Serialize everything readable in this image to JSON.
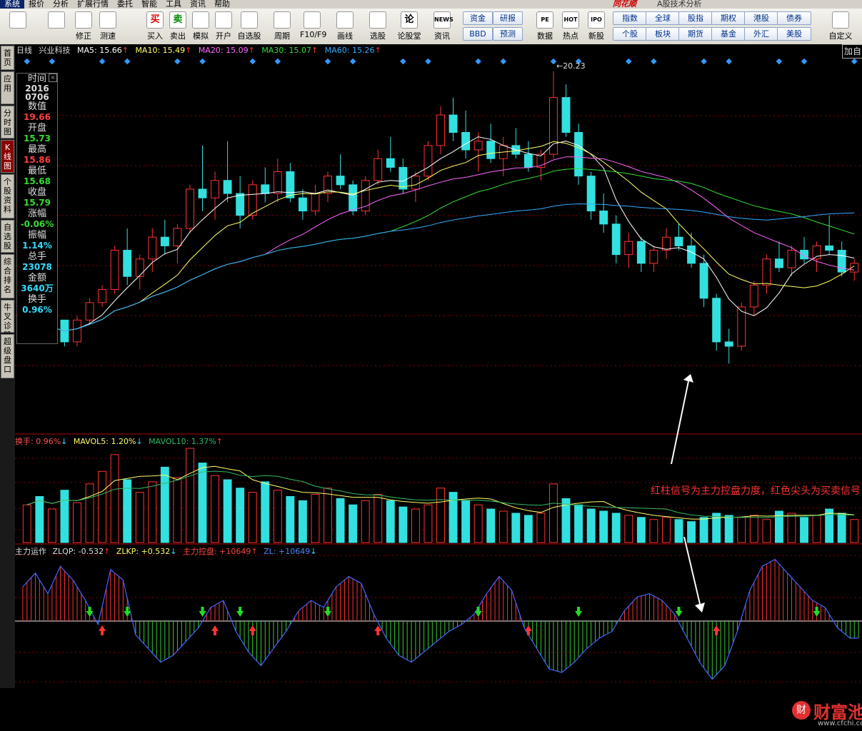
{
  "menu": {
    "items": [
      "系统",
      "报价",
      "分析",
      "扩展行情",
      "委托",
      "智能",
      "工具",
      "资讯",
      "帮助"
    ],
    "active_index": 0,
    "app_title": "同花顺",
    "subtitle": "A股技术分析"
  },
  "toolbar": {
    "buttons": [
      {
        "name": "layout-icon",
        "label": ""
      },
      {
        "name": "back-arrow-icon",
        "label": ""
      },
      {
        "name": "modify-button",
        "label": "修正"
      },
      {
        "name": "speed-test-button",
        "label": "测速"
      },
      {
        "name": "buy-button",
        "label": "买入",
        "glyph": "买"
      },
      {
        "name": "sell-button",
        "label": "卖出",
        "glyph": "卖"
      },
      {
        "name": "simulate-button",
        "label": "模拟"
      },
      {
        "name": "open-account-button",
        "label": "开户"
      },
      {
        "name": "watchlist-button",
        "label": "自选股"
      },
      {
        "name": "period-button",
        "label": "周期"
      },
      {
        "name": "f10-button",
        "label": "F10/F9"
      },
      {
        "name": "draw-line-button",
        "label": "画线"
      },
      {
        "name": "stock-select-button",
        "label": "选股"
      },
      {
        "name": "forum-button",
        "label": "论股堂",
        "glyph": "论"
      },
      {
        "name": "news-button",
        "label": "资讯",
        "glyph": "NEWS"
      },
      {
        "name": "data-button",
        "label": "数据",
        "glyph": "PE"
      },
      {
        "name": "hot-button",
        "label": "热点",
        "glyph": "HOT"
      },
      {
        "name": "new-stock-button",
        "label": "新股",
        "glyph": "IPO"
      },
      {
        "name": "customize-button",
        "label": "自定义"
      }
    ],
    "text_buttons": [
      "资金",
      "研报",
      "BBD",
      "预测",
      "指数",
      "全球",
      "股指",
      "期权",
      "港股",
      "债券",
      "个股",
      "板块",
      "期货",
      "基金",
      "外汇",
      "美股"
    ]
  },
  "left_nav": {
    "tabs": [
      "首页",
      "应用",
      "分时图",
      "K线图",
      "个股资料",
      "自选股",
      "综合排名",
      "牛叉诊股",
      "超级盘口"
    ],
    "active_index": 3
  },
  "kline_header": {
    "period": "日线",
    "stock_name": "兴业科技",
    "ma5": "MA5: 15.66",
    "ma10": "MA10: 15.49",
    "ma20": "MA20: 15.09",
    "ma30": "MA30: 15.07",
    "ma60": "MA60: 15.26",
    "add_button": "加自"
  },
  "info_box": {
    "items": [
      {
        "key": "时间",
        "value": "2016\n0706",
        "color": "#dddddd"
      },
      {
        "key": "数值",
        "value": "19.66",
        "color": "#ff4040"
      },
      {
        "key": "开盘",
        "value": "15.73",
        "color": "#33dd33"
      },
      {
        "key": "最高",
        "value": "15.86",
        "color": "#ff4040"
      },
      {
        "key": "最低",
        "value": "15.68",
        "color": "#33dd33"
      },
      {
        "key": "收盘",
        "value": "15.79",
        "color": "#33dd33"
      },
      {
        "key": "涨幅",
        "value": "-0.06%",
        "color": "#33dd33"
      },
      {
        "key": "振幅",
        "value": "1.14%",
        "color": "#33ddff"
      },
      {
        "key": "总手",
        "value": "23078",
        "color": "#33ddff"
      },
      {
        "key": "金额",
        "value": "3640万",
        "color": "#33ddff"
      },
      {
        "key": "换手",
        "value": "0.96%",
        "color": "#33ddff"
      }
    ],
    "close_glyph": "×"
  },
  "volume_header": {
    "turnover": "换手: 0.96%",
    "mavol5": "MAVOL5: 1.20%",
    "mavol10": "MAVOL10: 1.37%"
  },
  "zl_header": {
    "title": "主力运作",
    "zlqp": "ZLQP: -0.532",
    "zlkp": "ZLKP: +0.532",
    "zhulikongpan": "主力控盘: +10649",
    "zl": "ZL: +10649"
  },
  "annotation": {
    "text": "红柱信号为主力控盘力度，红色尖头为买卖信号"
  },
  "logo": {
    "mark": "财",
    "name": "财富池",
    "url": "www.cfchi.com"
  },
  "colors": {
    "up": "#ff3333",
    "down": "#33e0e0",
    "ma5": "#ffffff",
    "ma10": "#ffff66",
    "ma20": "#ff66ff",
    "ma30": "#33dd33",
    "ma60": "#33aaff",
    "grid": "#8b0000"
  },
  "chart_data": {
    "type": "candlestick",
    "price_high_label": "20.23",
    "price_max": 20.23,
    "price_min": 13.5,
    "candles": [
      [
        14.1,
        14.4,
        14.0,
        14.3
      ],
      [
        14.3,
        14.5,
        14.1,
        14.2
      ],
      [
        14.2,
        14.6,
        14.1,
        14.5
      ],
      [
        14.5,
        14.5,
        13.9,
        14.0
      ],
      [
        14.0,
        14.6,
        13.9,
        14.5
      ],
      [
        14.5,
        15.0,
        14.4,
        14.9
      ],
      [
        14.9,
        15.3,
        14.8,
        15.2
      ],
      [
        15.2,
        16.2,
        15.1,
        16.1
      ],
      [
        16.1,
        16.6,
        15.3,
        15.5
      ],
      [
        15.5,
        16.0,
        15.2,
        15.9
      ],
      [
        15.9,
        16.6,
        15.6,
        16.4
      ],
      [
        16.4,
        16.8,
        16.0,
        16.2
      ],
      [
        16.2,
        16.7,
        15.8,
        16.6
      ],
      [
        16.6,
        17.6,
        16.5,
        17.5
      ],
      [
        17.5,
        18.5,
        17.0,
        17.3
      ],
      [
        17.3,
        17.9,
        16.8,
        17.7
      ],
      [
        17.7,
        18.6,
        17.2,
        17.4
      ],
      [
        17.4,
        17.8,
        16.6,
        16.9
      ],
      [
        16.9,
        17.7,
        16.8,
        17.6
      ],
      [
        17.6,
        18.0,
        17.2,
        17.4
      ],
      [
        17.4,
        18.2,
        17.2,
        17.9
      ],
      [
        17.9,
        18.1,
        17.2,
        17.3
      ],
      [
        17.3,
        17.5,
        16.8,
        17.0
      ],
      [
        17.0,
        17.6,
        16.9,
        17.4
      ],
      [
        17.4,
        17.9,
        17.2,
        17.8
      ],
      [
        17.8,
        18.3,
        17.5,
        17.6
      ],
      [
        17.6,
        17.7,
        16.9,
        17.0
      ],
      [
        17.0,
        17.8,
        16.9,
        17.7
      ],
      [
        17.7,
        18.4,
        17.6,
        18.2
      ],
      [
        18.2,
        18.7,
        17.9,
        18.0
      ],
      [
        18.0,
        18.2,
        17.4,
        17.5
      ],
      [
        17.5,
        17.9,
        17.2,
        17.8
      ],
      [
        17.8,
        18.6,
        17.7,
        18.5
      ],
      [
        18.5,
        19.4,
        18.3,
        19.2
      ],
      [
        19.2,
        19.6,
        18.6,
        18.8
      ],
      [
        18.8,
        19.3,
        18.2,
        18.4
      ],
      [
        18.4,
        18.8,
        17.9,
        18.6
      ],
      [
        18.6,
        19.0,
        18.1,
        18.2
      ],
      [
        18.2,
        18.7,
        17.8,
        18.5
      ],
      [
        18.5,
        18.9,
        18.2,
        18.3
      ],
      [
        18.3,
        18.6,
        17.9,
        18.0
      ],
      [
        18.0,
        18.4,
        17.7,
        18.3
      ],
      [
        18.3,
        20.2,
        18.2,
        19.6
      ],
      [
        19.6,
        19.9,
        18.7,
        18.8
      ],
      [
        18.8,
        19.0,
        17.6,
        17.8
      ],
      [
        17.8,
        17.9,
        16.8,
        17.0
      ],
      [
        17.0,
        17.4,
        16.5,
        16.7
      ],
      [
        16.7,
        16.9,
        15.8,
        16.0
      ],
      [
        16.0,
        16.5,
        15.7,
        16.3
      ],
      [
        16.3,
        16.4,
        15.6,
        15.8
      ],
      [
        15.8,
        16.2,
        15.6,
        16.1
      ],
      [
        16.1,
        16.6,
        15.9,
        16.4
      ],
      [
        16.4,
        16.7,
        16.1,
        16.2
      ],
      [
        16.2,
        16.5,
        15.7,
        15.8
      ],
      [
        15.8,
        16.0,
        14.8,
        15.0
      ],
      [
        15.0,
        15.1,
        13.8,
        14.0
      ],
      [
        14.0,
        14.3,
        13.5,
        13.9
      ],
      [
        13.9,
        14.9,
        13.8,
        14.8
      ],
      [
        14.8,
        15.4,
        14.6,
        15.3
      ],
      [
        15.3,
        16.0,
        15.1,
        15.9
      ],
      [
        15.9,
        16.3,
        15.6,
        15.7
      ],
      [
        15.7,
        16.2,
        15.5,
        16.1
      ],
      [
        16.1,
        16.4,
        15.8,
        15.9
      ],
      [
        15.9,
        16.3,
        15.6,
        16.2
      ],
      [
        16.2,
        16.9,
        16.0,
        16.1
      ],
      [
        16.1,
        16.3,
        15.5,
        15.6
      ],
      [
        15.6,
        15.9,
        15.4,
        15.8
      ]
    ],
    "volume": [
      1.8,
      2.2,
      1.6,
      2.5,
      1.9,
      2.8,
      3.4,
      4.2,
      3.0,
      2.4,
      2.9,
      3.6,
      3.1,
      4.5,
      3.8,
      3.2,
      3.0,
      2.6,
      2.4,
      2.9,
      2.5,
      2.2,
      2.0,
      2.3,
      2.6,
      2.1,
      1.8,
      2.0,
      2.3,
      2.0,
      1.7,
      1.6,
      1.8,
      2.6,
      2.4,
      2.0,
      1.8,
      1.6,
      1.5,
      1.4,
      1.3,
      1.4,
      2.8,
      2.1,
      1.8,
      1.6,
      1.5,
      1.4,
      1.3,
      1.2,
      1.1,
      1.2,
      1.1,
      1.0,
      1.2,
      1.4,
      1.3,
      1.2,
      1.3,
      1.1,
      1.5,
      1.4,
      1.2,
      1.3,
      1.6,
      1.4,
      1.1
    ],
    "zl": [
      1.0,
      1.4,
      0.8,
      1.6,
      1.2,
      0.6,
      -0.1,
      1.5,
      1.2,
      -0.4,
      -0.8,
      -1.2,
      -1.0,
      -0.6,
      -0.2,
      0.4,
      0.6,
      -0.3,
      -0.9,
      -1.3,
      -0.8,
      -0.3,
      0.3,
      0.6,
      0.4,
      1.0,
      1.3,
      1.1,
      0.2,
      -0.5,
      -1.0,
      -1.2,
      -0.9,
      -0.6,
      -0.3,
      -0.1,
      0.2,
      0.8,
      1.3,
      0.9,
      -0.2,
      -0.8,
      -1.4,
      -1.5,
      -1.2,
      -0.8,
      -0.5,
      -0.3,
      0.3,
      0.7,
      0.8,
      0.6,
      0.2,
      -0.5,
      -1.2,
      -1.7,
      -1.3,
      -0.3,
      0.9,
      1.6,
      1.8,
      1.4,
      1.0,
      0.6,
      0.4,
      -0.2,
      -0.5
    ],
    "buy_signals": [
      6,
      15,
      18,
      28,
      40,
      55
    ],
    "sell_signals": [
      5,
      8,
      14,
      17,
      24,
      36,
      44,
      52,
      63
    ]
  }
}
